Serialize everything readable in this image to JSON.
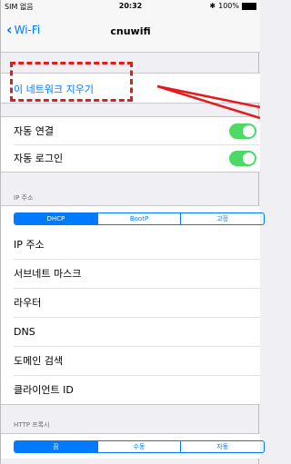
{
  "status_bar": {
    "carrier": "SIM 없음",
    "time": "20:32",
    "battery": "100%"
  },
  "nav": {
    "back_label": "Wi-Fi",
    "title": "cnuwifi"
  },
  "forget_network": "이 네트워크 지우기",
  "auto_settings": [
    {
      "label": "자동 연결",
      "on": true
    },
    {
      "label": "자동 로그인",
      "on": true
    }
  ],
  "ip_section": {
    "header": "IP 주소",
    "segments": [
      "DHCP",
      "BootP",
      "고정"
    ],
    "selected": "DHCP",
    "rows": [
      "IP 주소",
      "서브네트 마스크",
      "라우터",
      "DNS",
      "도메인 검색",
      "클라이언트 ID"
    ]
  },
  "proxy_section": {
    "header": "HTTP 프록시",
    "segments": [
      "끔",
      "수동",
      "자동"
    ],
    "selected": "끔"
  },
  "colors": {
    "accent": "#007aff",
    "switch_on": "#4cd964",
    "annotation": "#e31b1b"
  }
}
